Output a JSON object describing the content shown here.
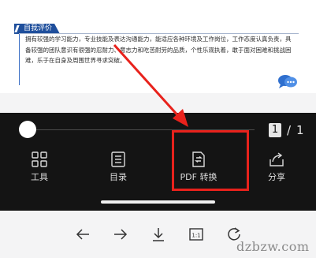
{
  "document": {
    "section_title": "自我评价",
    "lines": [
      "拥有较强的学习能力，专业技能及表达沟通能力，能适应各种环境及工作岗位，工作态度认真负责，具",
      "备较强的团队意识有很强的忍耐力、意志力和吃苦耐劳的品质，个性乐观执着，敢于面对困难和挑战困",
      "难，乐于在自身及周围世界寻求突破。"
    ]
  },
  "page_indicator": {
    "current": "1",
    "separator": "/",
    "total": "1"
  },
  "toolbar": {
    "tools_label": "工具",
    "contents_label": "目录",
    "pdf_convert_label": "PDF 转换",
    "share_label": "分享"
  },
  "watermark": "dzbzw.com",
  "colors": {
    "annotation": "#e8221c",
    "section_tab": "#1f4f9c",
    "panel": "#141414"
  }
}
